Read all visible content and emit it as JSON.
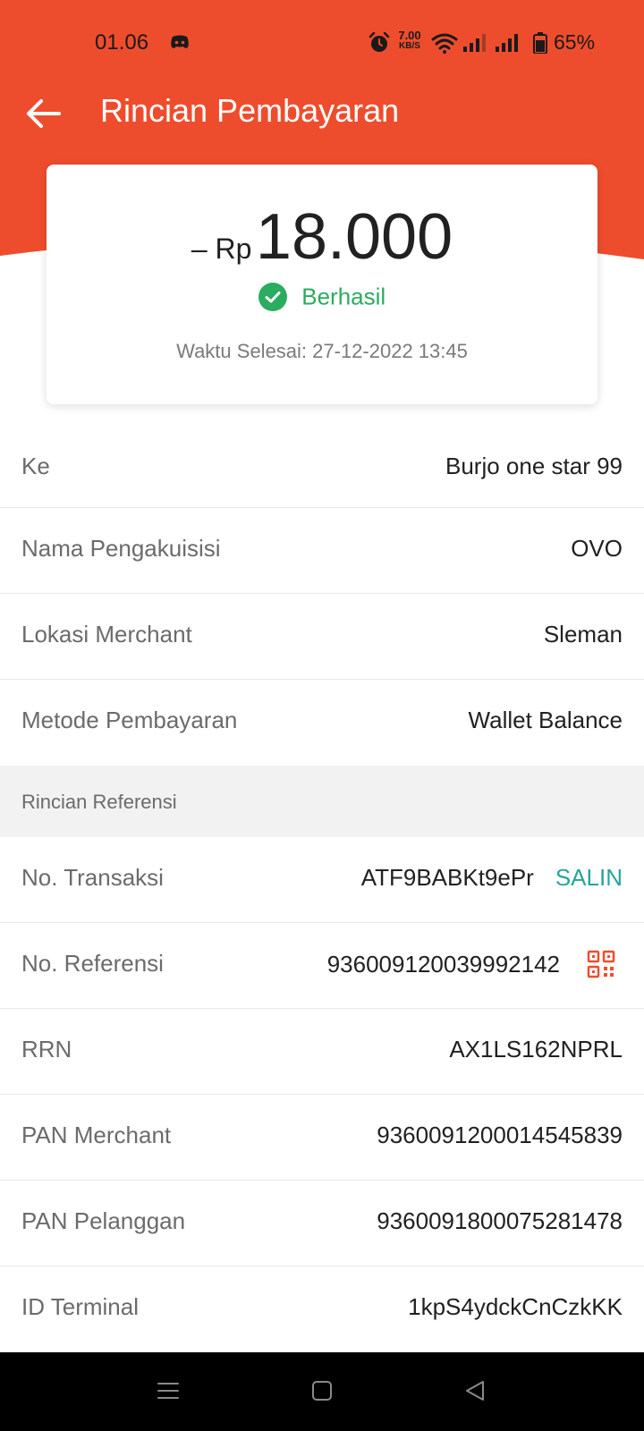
{
  "status_bar": {
    "time": "01.06",
    "net_speed_value": "7.00",
    "net_speed_unit": "KB/S",
    "battery": "65%"
  },
  "header": {
    "title": "Rincian Pembayaran"
  },
  "summary": {
    "prefix": "– Rp",
    "amount": "18.000",
    "status": "Berhasil",
    "completed_time": "Waktu Selesai: 27-12-2022 13:45"
  },
  "details": {
    "to_label": "Ke",
    "to_value": "Burjo one star 99",
    "acquirer_label": "Nama Pengakuisisi",
    "acquirer_value": "OVO",
    "location_label": "Lokasi Merchant",
    "location_value": "Sleman",
    "method_label": "Metode Pembayaran",
    "method_value": "Wallet Balance"
  },
  "reference": {
    "section_title": "Rincian Referensi",
    "trx_label": "No. Transaksi",
    "trx_value": "ATF9BABKt9ePr",
    "copy_label": "SALIN",
    "ref_label": "No. Referensi",
    "ref_value": "936009120039992142",
    "rrn_label": "RRN",
    "rrn_value": "AX1LS162NPRL",
    "pan_merchant_label": "PAN Merchant",
    "pan_merchant_value": "936009120001454583​9",
    "pan_customer_label": "PAN Pelanggan",
    "pan_customer_value": "9360091800075281478",
    "terminal_label": "ID Terminal",
    "terminal_value": "1kpS4ydckCnCzkKK"
  },
  "colors": {
    "brand": "#ee4d2d",
    "success": "#2bac5e",
    "link": "#26a69a"
  }
}
